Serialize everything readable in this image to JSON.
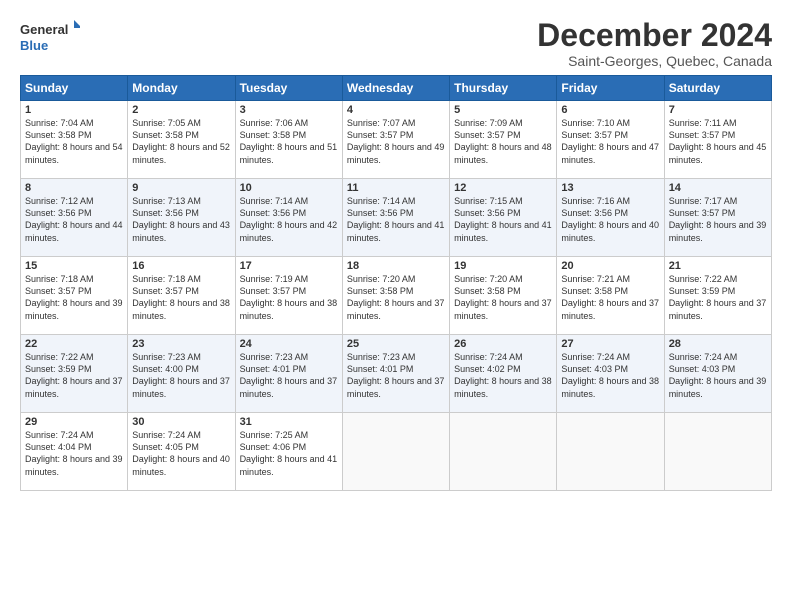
{
  "logo": {
    "line1": "General",
    "line2": "Blue"
  },
  "title": "December 2024",
  "subtitle": "Saint-Georges, Quebec, Canada",
  "days_of_week": [
    "Sunday",
    "Monday",
    "Tuesday",
    "Wednesday",
    "Thursday",
    "Friday",
    "Saturday"
  ],
  "weeks": [
    [
      {
        "day": "1",
        "sunrise": "7:04 AM",
        "sunset": "3:58 PM",
        "daylight": "8 hours and 54 minutes."
      },
      {
        "day": "2",
        "sunrise": "7:05 AM",
        "sunset": "3:58 PM",
        "daylight": "8 hours and 52 minutes."
      },
      {
        "day": "3",
        "sunrise": "7:06 AM",
        "sunset": "3:58 PM",
        "daylight": "8 hours and 51 minutes."
      },
      {
        "day": "4",
        "sunrise": "7:07 AM",
        "sunset": "3:57 PM",
        "daylight": "8 hours and 49 minutes."
      },
      {
        "day": "5",
        "sunrise": "7:09 AM",
        "sunset": "3:57 PM",
        "daylight": "8 hours and 48 minutes."
      },
      {
        "day": "6",
        "sunrise": "7:10 AM",
        "sunset": "3:57 PM",
        "daylight": "8 hours and 47 minutes."
      },
      {
        "day": "7",
        "sunrise": "7:11 AM",
        "sunset": "3:57 PM",
        "daylight": "8 hours and 45 minutes."
      }
    ],
    [
      {
        "day": "8",
        "sunrise": "7:12 AM",
        "sunset": "3:56 PM",
        "daylight": "8 hours and 44 minutes."
      },
      {
        "day": "9",
        "sunrise": "7:13 AM",
        "sunset": "3:56 PM",
        "daylight": "8 hours and 43 minutes."
      },
      {
        "day": "10",
        "sunrise": "7:14 AM",
        "sunset": "3:56 PM",
        "daylight": "8 hours and 42 minutes."
      },
      {
        "day": "11",
        "sunrise": "7:14 AM",
        "sunset": "3:56 PM",
        "daylight": "8 hours and 41 minutes."
      },
      {
        "day": "12",
        "sunrise": "7:15 AM",
        "sunset": "3:56 PM",
        "daylight": "8 hours and 41 minutes."
      },
      {
        "day": "13",
        "sunrise": "7:16 AM",
        "sunset": "3:56 PM",
        "daylight": "8 hours and 40 minutes."
      },
      {
        "day": "14",
        "sunrise": "7:17 AM",
        "sunset": "3:57 PM",
        "daylight": "8 hours and 39 minutes."
      }
    ],
    [
      {
        "day": "15",
        "sunrise": "7:18 AM",
        "sunset": "3:57 PM",
        "daylight": "8 hours and 39 minutes."
      },
      {
        "day": "16",
        "sunrise": "7:18 AM",
        "sunset": "3:57 PM",
        "daylight": "8 hours and 38 minutes."
      },
      {
        "day": "17",
        "sunrise": "7:19 AM",
        "sunset": "3:57 PM",
        "daylight": "8 hours and 38 minutes."
      },
      {
        "day": "18",
        "sunrise": "7:20 AM",
        "sunset": "3:58 PM",
        "daylight": "8 hours and 37 minutes."
      },
      {
        "day": "19",
        "sunrise": "7:20 AM",
        "sunset": "3:58 PM",
        "daylight": "8 hours and 37 minutes."
      },
      {
        "day": "20",
        "sunrise": "7:21 AM",
        "sunset": "3:58 PM",
        "daylight": "8 hours and 37 minutes."
      },
      {
        "day": "21",
        "sunrise": "7:22 AM",
        "sunset": "3:59 PM",
        "daylight": "8 hours and 37 minutes."
      }
    ],
    [
      {
        "day": "22",
        "sunrise": "7:22 AM",
        "sunset": "3:59 PM",
        "daylight": "8 hours and 37 minutes."
      },
      {
        "day": "23",
        "sunrise": "7:23 AM",
        "sunset": "4:00 PM",
        "daylight": "8 hours and 37 minutes."
      },
      {
        "day": "24",
        "sunrise": "7:23 AM",
        "sunset": "4:01 PM",
        "daylight": "8 hours and 37 minutes."
      },
      {
        "day": "25",
        "sunrise": "7:23 AM",
        "sunset": "4:01 PM",
        "daylight": "8 hours and 37 minutes."
      },
      {
        "day": "26",
        "sunrise": "7:24 AM",
        "sunset": "4:02 PM",
        "daylight": "8 hours and 38 minutes."
      },
      {
        "day": "27",
        "sunrise": "7:24 AM",
        "sunset": "4:03 PM",
        "daylight": "8 hours and 38 minutes."
      },
      {
        "day": "28",
        "sunrise": "7:24 AM",
        "sunset": "4:03 PM",
        "daylight": "8 hours and 39 minutes."
      }
    ],
    [
      {
        "day": "29",
        "sunrise": "7:24 AM",
        "sunset": "4:04 PM",
        "daylight": "8 hours and 39 minutes."
      },
      {
        "day": "30",
        "sunrise": "7:24 AM",
        "sunset": "4:05 PM",
        "daylight": "8 hours and 40 minutes."
      },
      {
        "day": "31",
        "sunrise": "7:25 AM",
        "sunset": "4:06 PM",
        "daylight": "8 hours and 41 minutes."
      },
      null,
      null,
      null,
      null
    ]
  ]
}
